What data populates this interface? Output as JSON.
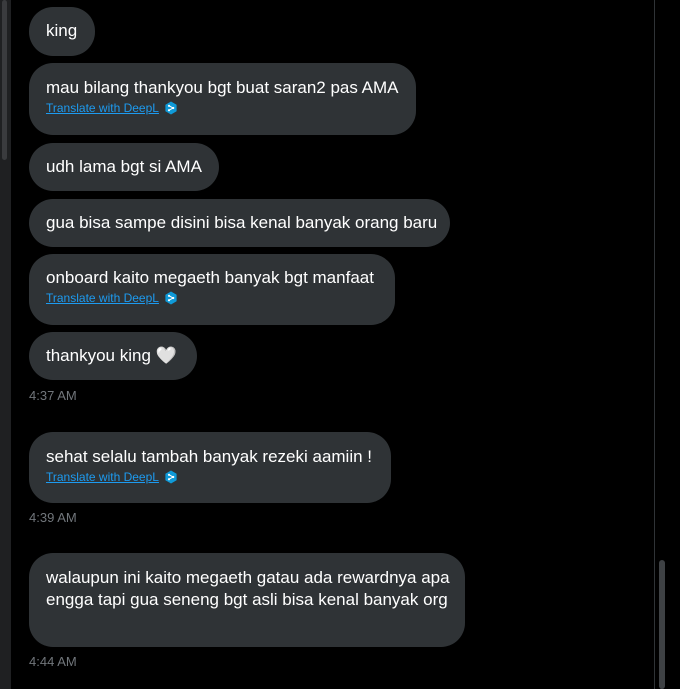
{
  "messages": [
    {
      "text": "king"
    },
    {
      "text": "mau bilang thankyou bgt buat saran2 pas AMA",
      "translate": "Translate with DeepL"
    },
    {
      "text": "udh lama bgt si AMA"
    },
    {
      "text": "gua bisa sampe disini bisa kenal banyak orang baru"
    },
    {
      "text": "onboard kaito megaeth banyak bgt manfaat",
      "translate": "Translate with DeepL"
    },
    {
      "text": "thankyou king 🤍"
    },
    {
      "text": "sehat selalu tambah banyak rezeki aamiin  !",
      "translate": "Translate with DeepL"
    },
    {
      "text": "walaupun ini kaito megaeth gatau ada rewardnya apa engga tapi gua seneng bgt asli bisa kenal banyak org"
    }
  ],
  "timestamps": [
    "4:37 AM",
    "4:39 AM",
    "4:44 AM"
  ],
  "colors": {
    "background": "#000000",
    "bubble": "#2f3336",
    "text": "#ffffff",
    "link": "#1d9bf0",
    "timestamp": "#71767b"
  },
  "icons": {
    "translate": "deepl-icon"
  }
}
